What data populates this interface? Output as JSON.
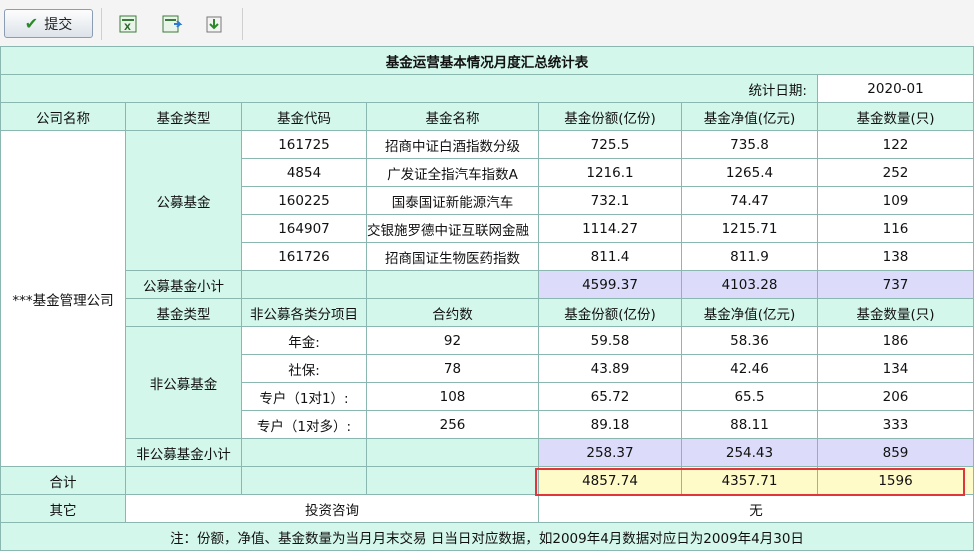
{
  "toolbar": {
    "submit_label": "提交",
    "icons": [
      "excel-export-icon",
      "excel-import-icon",
      "download-icon"
    ]
  },
  "report": {
    "title": "基金运营基本情况月度汇总统计表",
    "date_label": "统计日期:",
    "date_value": "2020-01",
    "headers": {
      "company": "公司名称",
      "fund_type": "基金类型",
      "fund_code": "基金代码",
      "fund_name": "基金名称",
      "share": "基金份额(亿份)",
      "nav": "基金净值(亿元)",
      "count": "基金数量(只)"
    },
    "company_name": "***基金管理公司",
    "public": {
      "type_label": "公募基金",
      "rows": [
        {
          "code": "161725",
          "name": "招商中证白酒指数分级",
          "share": "725.5",
          "nav": "735.8",
          "count": "122"
        },
        {
          "code": "4854",
          "name": "广发证全指汽车指数A",
          "share": "1216.1",
          "nav": "1265.4",
          "count": "252"
        },
        {
          "code": "160225",
          "name": "国泰国证新能源汽车",
          "share": "732.1",
          "nav": "74.47",
          "count": "109"
        },
        {
          "code": "164907",
          "name": "交银施罗德中证互联网金融",
          "share": "1114.27",
          "nav": "1215.71",
          "count": "116"
        },
        {
          "code": "161726",
          "name": "招商国证生物医药指数",
          "share": "811.4",
          "nav": "811.9",
          "count": "138"
        }
      ],
      "subtotal_label": "公募基金小计",
      "subtotal": {
        "share": "4599.37",
        "nav": "4103.28",
        "count": "737"
      }
    },
    "non_public": {
      "header_type": "基金类型",
      "header_item": "非公募各类分项目",
      "header_contracts": "合约数",
      "header_share": "基金份额(亿份)",
      "header_nav": "基金净值(亿元)",
      "header_count": "基金数量(只)",
      "type_label": "非公募基金",
      "rows": [
        {
          "item": "年金:",
          "contracts": "92",
          "share": "59.58",
          "nav": "58.36",
          "count": "186"
        },
        {
          "item": "社保:",
          "contracts": "78",
          "share": "43.89",
          "nav": "42.46",
          "count": "134"
        },
        {
          "item": "专户（1对1）:",
          "contracts": "108",
          "share": "65.72",
          "nav": "65.5",
          "count": "206"
        },
        {
          "item": "专户（1对多）:",
          "contracts": "256",
          "share": "89.18",
          "nav": "88.11",
          "count": "333"
        }
      ],
      "subtotal_label": "非公募基金小计",
      "subtotal": {
        "share": "258.37",
        "nav": "254.43",
        "count": "859"
      }
    },
    "total": {
      "label": "合计",
      "share": "4857.74",
      "nav": "4357.71",
      "count": "1596"
    },
    "other": {
      "label": "其它",
      "left_value": "投资咨询",
      "right_value": "无"
    },
    "note": "注：份额，净值、基金数量为当月月末交易 日当日对应数据，如2009年4月数据对应日为2009年4月30日"
  }
}
